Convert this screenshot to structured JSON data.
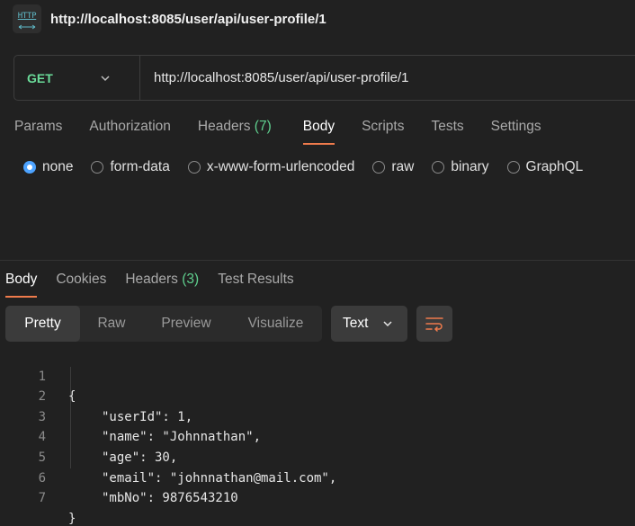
{
  "request": {
    "title": "http://localhost:8085/user/api/user-profile/1",
    "icon_label": "HTTP",
    "icon": "http-request-icon",
    "method": "GET",
    "url": "http://localhost:8085/user/api/user-profile/1"
  },
  "request_tabs": [
    {
      "label": "Params",
      "count": ""
    },
    {
      "label": "Authorization",
      "count": ""
    },
    {
      "label": "Headers",
      "count": "(7)"
    },
    {
      "label": "Body",
      "count": ""
    },
    {
      "label": "Scripts",
      "count": ""
    },
    {
      "label": "Tests",
      "count": ""
    },
    {
      "label": "Settings",
      "count": ""
    }
  ],
  "active_request_tab": "Body",
  "body_types": [
    "none",
    "form-data",
    "x-www-form-urlencoded",
    "raw",
    "binary",
    "GraphQL"
  ],
  "selected_body_type": "none",
  "response_tabs": [
    {
      "label": "Body",
      "count": ""
    },
    {
      "label": "Cookies",
      "count": ""
    },
    {
      "label": "Headers",
      "count": "(3)"
    },
    {
      "label": "Test Results",
      "count": ""
    }
  ],
  "active_response_tab": "Body",
  "view_modes": [
    "Pretty",
    "Raw",
    "Preview",
    "Visualize"
  ],
  "active_view_mode": "Pretty",
  "response_format": "Text",
  "response_lines": [
    {
      "num": "1",
      "text": "{"
    },
    {
      "num": "2",
      "text": "\"userId\": 1,"
    },
    {
      "num": "3",
      "text": "\"name\": \"Johnnathan\","
    },
    {
      "num": "4",
      "text": "\"age\": 30,"
    },
    {
      "num": "5",
      "text": "\"email\": \"johnnathan@mail.com\","
    },
    {
      "num": "6",
      "text": "\"mbNo\": 9876543210"
    },
    {
      "num": "7",
      "text": "}"
    }
  ],
  "colors": {
    "background": "#212121",
    "method_get": "#6bdd9a",
    "active_tab_underline": "#ef7b4c",
    "count_badge": "#5fcf8e",
    "radio_selected": "#4da3ff"
  }
}
